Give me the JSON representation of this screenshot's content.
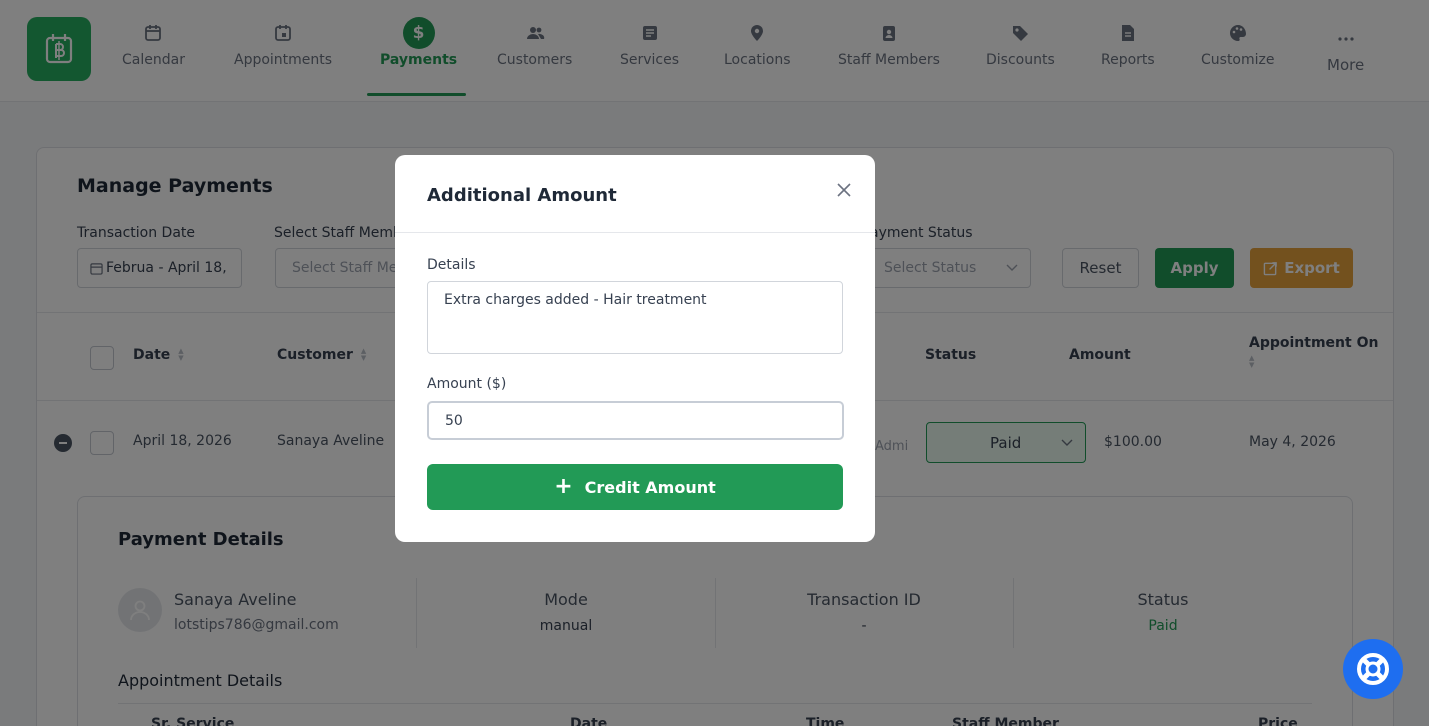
{
  "nav": {
    "items": [
      {
        "label": "Calendar",
        "icon": "calendar-icon"
      },
      {
        "label": "Appointments",
        "icon": "calendar-check-icon"
      },
      {
        "label": "Payments",
        "icon": "dollar-icon",
        "active": true
      },
      {
        "label": "Customers",
        "icon": "users-icon"
      },
      {
        "label": "Services",
        "icon": "services-icon"
      },
      {
        "label": "Locations",
        "icon": "location-pin-icon"
      },
      {
        "label": "Staff Members",
        "icon": "id-badge-icon"
      },
      {
        "label": "Discounts",
        "icon": "tag-icon"
      },
      {
        "label": "Reports",
        "icon": "report-icon"
      },
      {
        "label": "Customize",
        "icon": "palette-icon"
      },
      {
        "label": "More",
        "icon": "more-dots-icon"
      }
    ],
    "accent": "#229a56"
  },
  "page": {
    "title": "Manage Payments",
    "filters": {
      "transaction_date_label": "Transaction Date",
      "transaction_date_value": "Februa  -  April 18,",
      "staff_label": "Select Staff Memb",
      "staff_placeholder": "Select Staff Me",
      "payment_status_label": "ayment Status",
      "payment_status_placeholder": "Select Status"
    },
    "buttons": {
      "reset": "Reset",
      "apply": "Apply",
      "export": "Export"
    },
    "table": {
      "headers": {
        "date": "Date",
        "customer": "Customer",
        "status": "Status",
        "amount": "Amount",
        "appointment_on": "Appointment On"
      },
      "row": {
        "date": "April 18, 2026",
        "customer": "Sanaya Aveline",
        "staff_partial": "Admi",
        "status": "Paid",
        "amount": "$100.00",
        "appointment_on": "May 4, 2026"
      }
    },
    "payment_details": {
      "title": "Payment Details",
      "customer_name": "Sanaya Aveline",
      "customer_email": "lotstips786@gmail.com",
      "mode_label": "Mode",
      "mode_value": "manual",
      "transaction_label": "Transaction ID",
      "transaction_value": "-",
      "status_label": "Status",
      "status_value": "Paid"
    },
    "appointment_details": {
      "title": "Appointment Details",
      "headers": [
        "Sr. Service",
        "Date",
        "Time",
        "Staff Member",
        "Price"
      ]
    }
  },
  "modal": {
    "title": "Additional Amount",
    "details_label": "Details",
    "details_value": "Extra charges added - Hair treatment",
    "amount_label": "Amount ($)",
    "amount_value": "50",
    "submit_label": "Credit Amount"
  },
  "colors": {
    "primary": "#229a56",
    "export": "#e6a23c",
    "help": "#1e6ef0"
  }
}
